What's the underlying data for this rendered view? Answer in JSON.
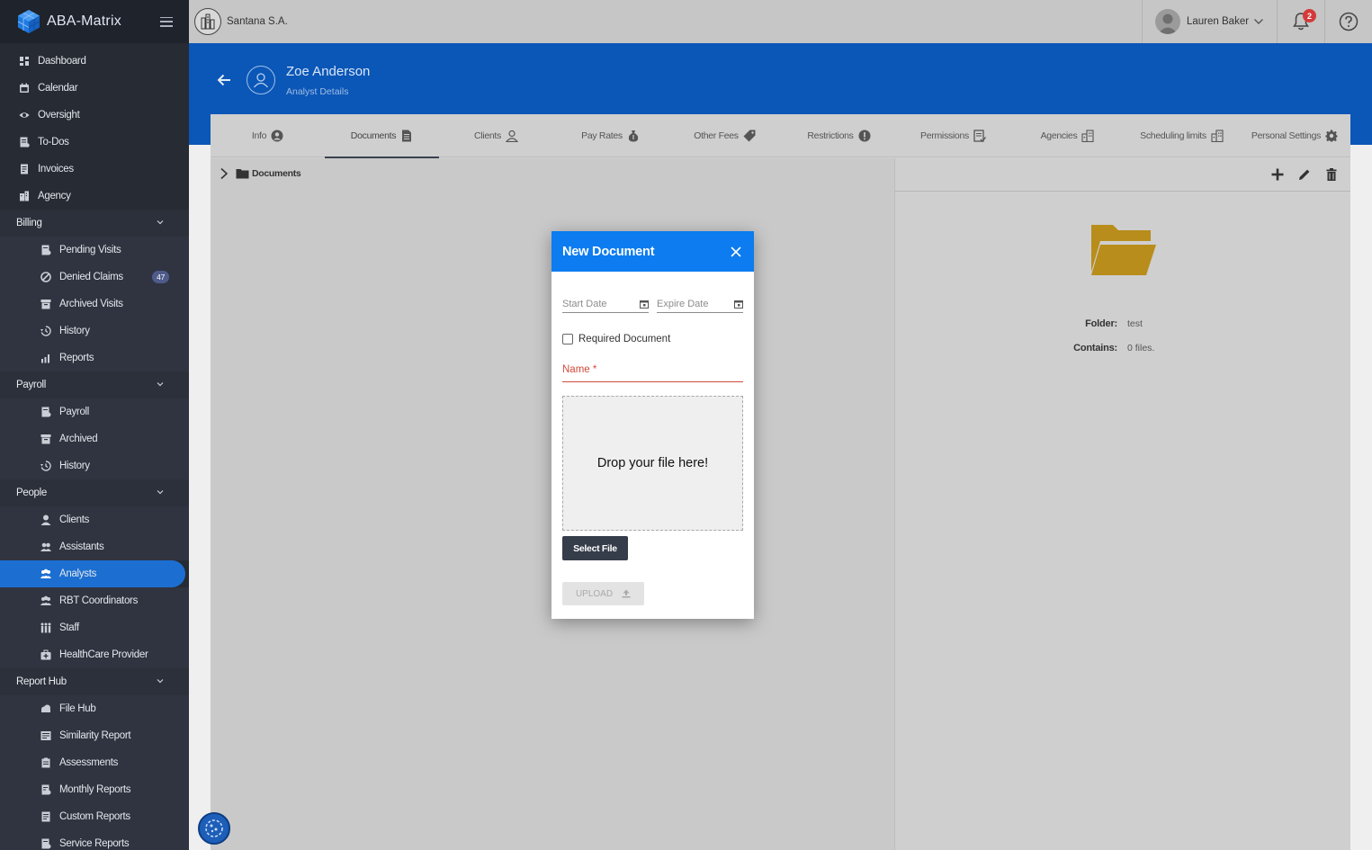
{
  "app": {
    "name": "ABA-Matrix"
  },
  "topbar": {
    "company": "Santana S.A.",
    "user": "Lauren Baker",
    "notifications_count": "2"
  },
  "sidebar": {
    "top_items": [
      {
        "label": "Dashboard",
        "icon": "dashboard-icon"
      },
      {
        "label": "Calendar",
        "icon": "calendar-icon"
      },
      {
        "label": "Oversight",
        "icon": "eye-icon"
      },
      {
        "label": "To-Dos",
        "icon": "todo-icon"
      },
      {
        "label": "Invoices",
        "icon": "invoice-icon"
      },
      {
        "label": "Agency",
        "icon": "agency-icon"
      }
    ],
    "billing": {
      "label": "Billing",
      "items": [
        {
          "label": "Pending Visits",
          "icon": "pending-icon"
        },
        {
          "label": "Denied Claims",
          "icon": "denied-icon",
          "badge": "47"
        },
        {
          "label": "Archived Visits",
          "icon": "archive-icon"
        },
        {
          "label": "History",
          "icon": "history-icon"
        },
        {
          "label": "Reports",
          "icon": "reports-icon"
        }
      ]
    },
    "payroll": {
      "label": "Payroll",
      "items": [
        {
          "label": "Payroll",
          "icon": "payroll-icon"
        },
        {
          "label": "Archived",
          "icon": "archive-icon"
        },
        {
          "label": "History",
          "icon": "history-icon"
        }
      ]
    },
    "people": {
      "label": "People",
      "items": [
        {
          "label": "Clients",
          "icon": "client-icon"
        },
        {
          "label": "Assistants",
          "icon": "assistants-icon"
        },
        {
          "label": "Analysts",
          "icon": "analysts-icon"
        },
        {
          "label": "RBT Coordinators",
          "icon": "coordinators-icon"
        },
        {
          "label": "Staff",
          "icon": "staff-icon"
        },
        {
          "label": "HealthCare Provider",
          "icon": "healthcare-icon"
        }
      ]
    },
    "report_hub": {
      "label": "Report Hub",
      "items": [
        {
          "label": "File Hub",
          "icon": "cloud-icon"
        },
        {
          "label": "Similarity Report",
          "icon": "similarity-icon"
        },
        {
          "label": "Assessments",
          "icon": "assessments-icon"
        },
        {
          "label": "Monthly Reports",
          "icon": "monthly-icon"
        },
        {
          "label": "Custom Reports",
          "icon": "custom-icon"
        },
        {
          "label": "Service Reports",
          "icon": "service-icon"
        }
      ]
    }
  },
  "header": {
    "name": "Zoe Anderson",
    "subtitle": "Analyst Details"
  },
  "tabs": [
    {
      "label": "Info",
      "icon": "user-circle-icon"
    },
    {
      "label": "Documents",
      "icon": "document-icon"
    },
    {
      "label": "Clients",
      "icon": "client-icon"
    },
    {
      "label": "Pay Rates",
      "icon": "money-bag-icon"
    },
    {
      "label": "Other Fees",
      "icon": "tag-icon"
    },
    {
      "label": "Restrictions",
      "icon": "alert-icon"
    },
    {
      "label": "Permissions",
      "icon": "permissions-icon"
    },
    {
      "label": "Agencies",
      "icon": "building-icon"
    },
    {
      "label": "Scheduling limits",
      "icon": "building-icon"
    },
    {
      "label": "Personal Settings",
      "icon": "gear-icon"
    }
  ],
  "active_tab": "Documents",
  "tree": {
    "root": "Documents"
  },
  "folder_info": {
    "folder_label": "Folder:",
    "folder_value": "test",
    "contains_label": "Contains:",
    "contains_value": "0 files."
  },
  "modal": {
    "title": "New Document",
    "start_date_placeholder": "Start Date",
    "expire_date_placeholder": "Expire Date",
    "required_label": "Required Document",
    "name_placeholder": "Name *",
    "dropzone_text": "Drop your file here!",
    "select_file_label": "Select File",
    "upload_label": "UPLOAD"
  },
  "colors": {
    "primary": "#0b57b7",
    "modal_header": "#0c7cf0",
    "sidebar": "#262b34",
    "active_item": "#1c6fd1",
    "error": "#d14a3a",
    "folder": "#b88d1b"
  }
}
